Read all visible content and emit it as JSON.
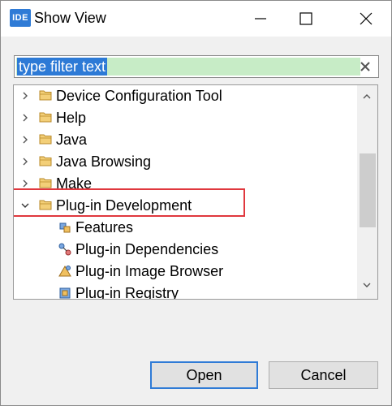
{
  "window": {
    "title": "Show View",
    "app_icon_text": "IDE"
  },
  "filter": {
    "value": "type filter text"
  },
  "tree": {
    "items": [
      {
        "label": "Device Configuration Tool",
        "type": "folder",
        "expanded": false
      },
      {
        "label": "Help",
        "type": "folder",
        "expanded": false
      },
      {
        "label": "Java",
        "type": "folder",
        "expanded": false
      },
      {
        "label": "Java Browsing",
        "type": "folder",
        "expanded": false
      },
      {
        "label": "Make",
        "type": "folder",
        "expanded": false
      },
      {
        "label": "Plug-in Development",
        "type": "folder",
        "expanded": true,
        "highlighted": true
      },
      {
        "label": "Features",
        "type": "view",
        "icon": "features-icon"
      },
      {
        "label": "Plug-in Dependencies",
        "type": "view",
        "icon": "plugin-dependencies-icon"
      },
      {
        "label": "Plug-in Image Browser",
        "type": "view",
        "icon": "image-browser-icon"
      },
      {
        "label": "Plug-in Registry",
        "type": "view",
        "icon": "plugin-registry-icon"
      }
    ]
  },
  "buttons": {
    "open": "Open",
    "cancel": "Cancel"
  },
  "colors": {
    "accent": "#2f7bd6",
    "selection_bg": "#c7ecc6",
    "highlight_box": "#e0383e",
    "folder": "#e8b54a"
  }
}
